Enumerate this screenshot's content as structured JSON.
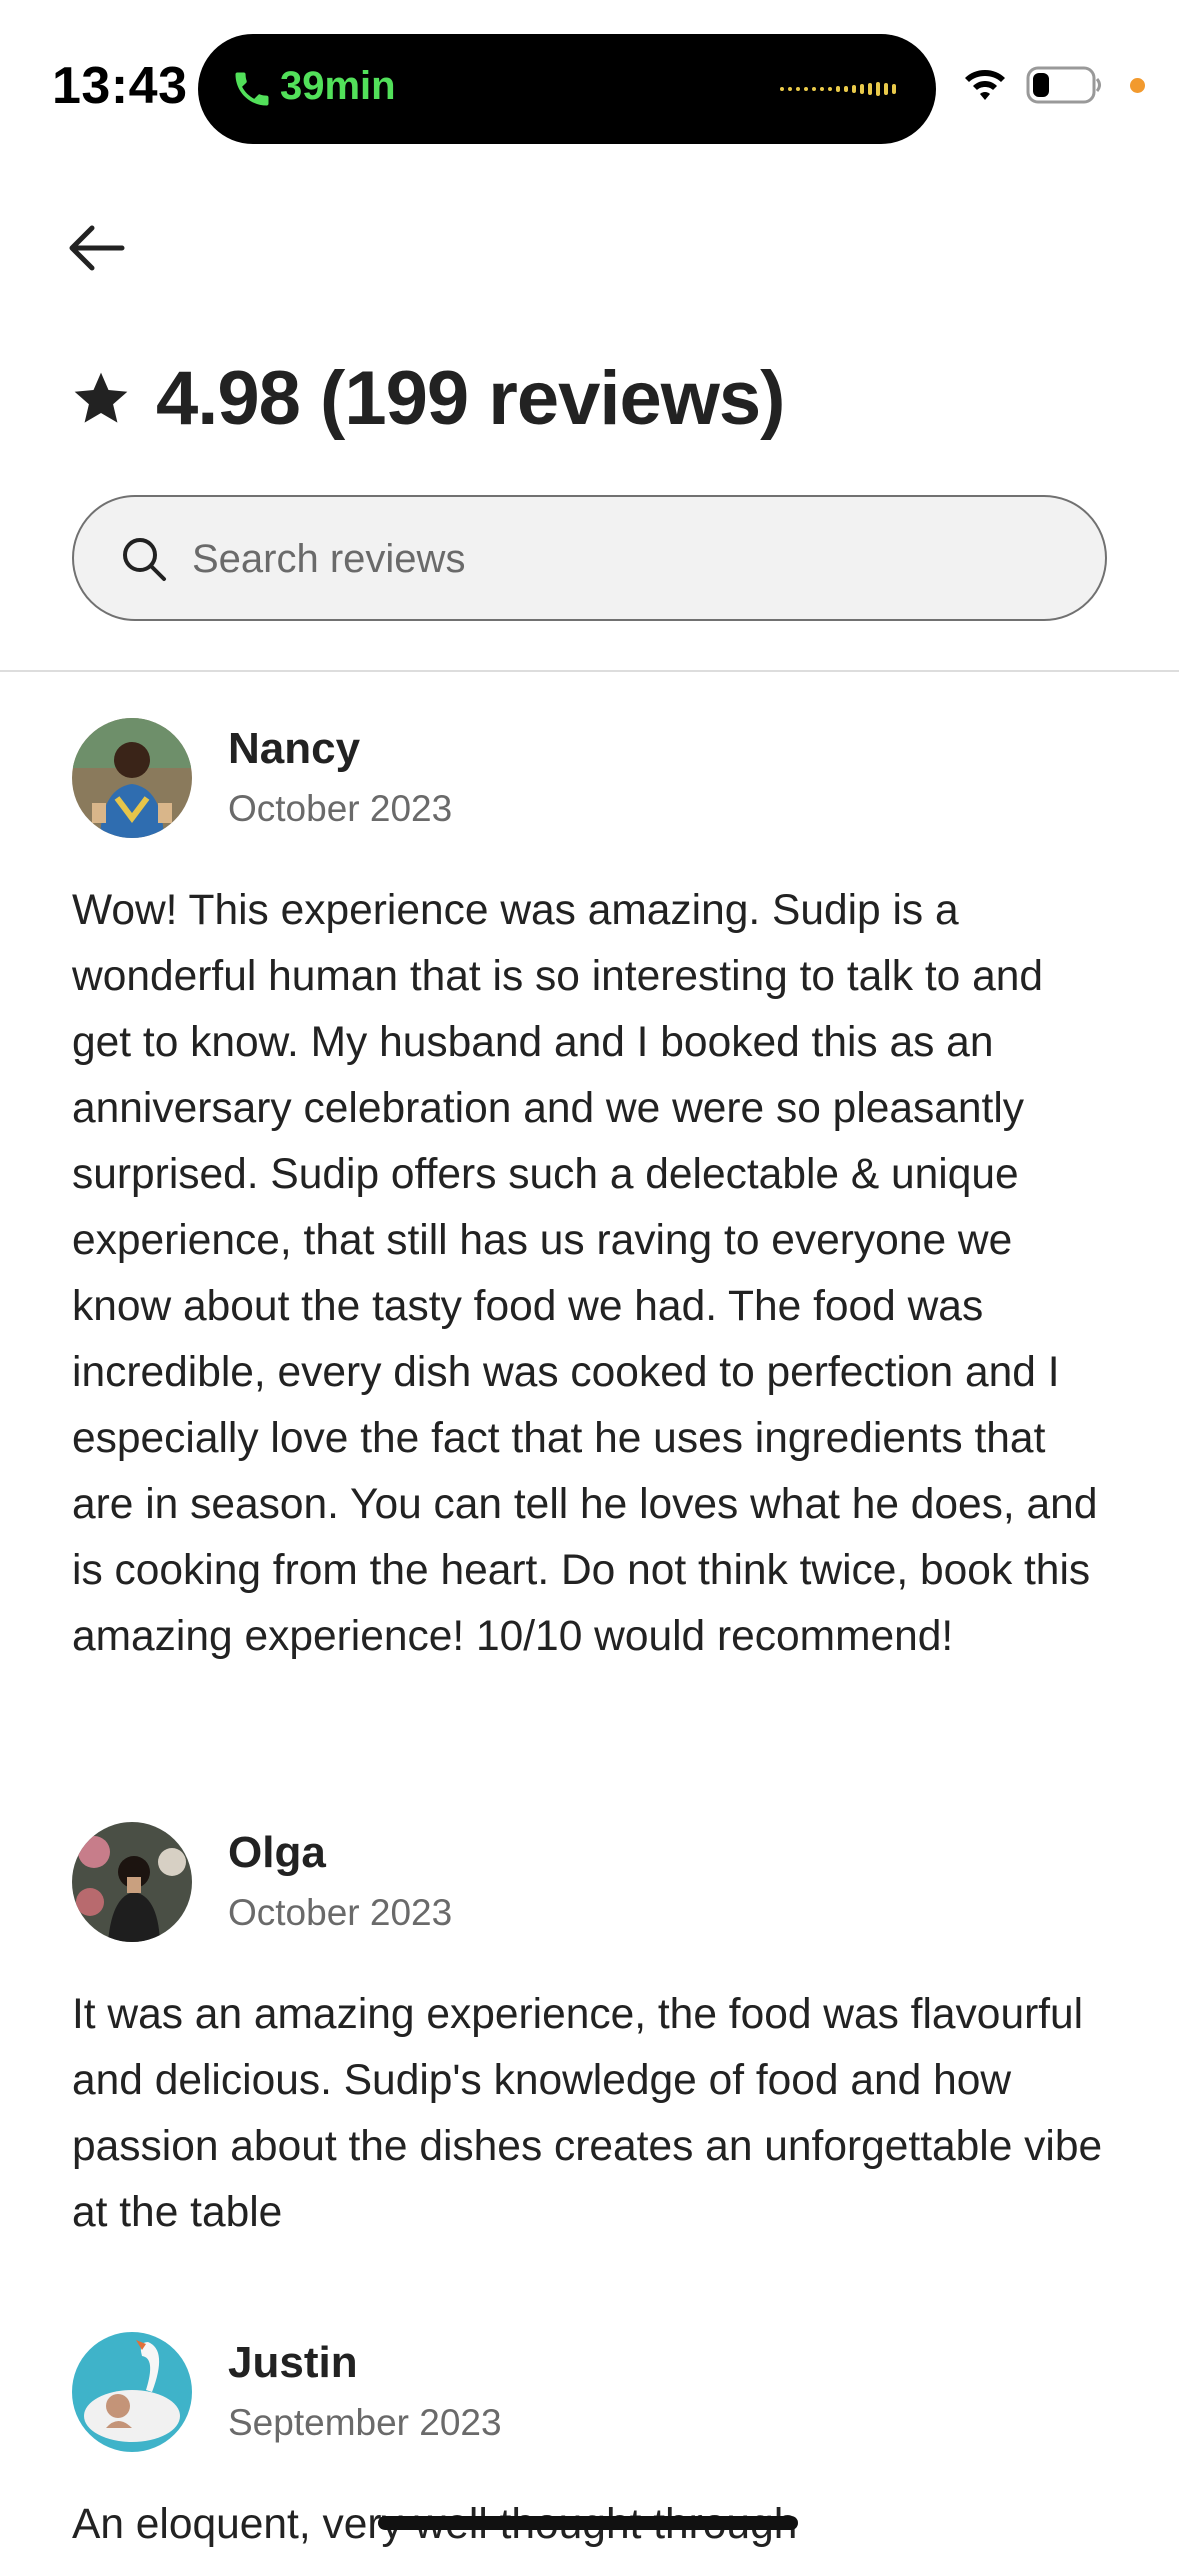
{
  "status_bar": {
    "time": "13:43",
    "call_duration": "39min",
    "call_color": "#52e05a",
    "icons": [
      "phone-icon",
      "audio-wave-icon",
      "wifi-icon",
      "battery-icon",
      "privacy-dot"
    ]
  },
  "header": {
    "back_icon": "arrow-left-icon",
    "rating_icon": "star-icon",
    "rating_text": "4.98 (199 reviews)"
  },
  "search": {
    "placeholder": "Search reviews",
    "value": "",
    "icon": "search-icon"
  },
  "reviews": [
    {
      "name": "Nancy",
      "date": "October 2023",
      "text": "Wow! This experience was amazing. Sudip is a wonderful human that is so interesting to talk to and get to know. My husband and I booked this as an anniversary celebration and we were so pleasantly surprised. Sudip offers such a delectable & unique experience, that still has us raving to everyone we know about the tasty food we had. The food was incredible, every dish was cooked to perfection and I especially love the fact that he uses ingredients that are in season. You can tell he loves what he does, and is cooking from the heart. Do not think twice, book this amazing experience! 10/10 would recommend!"
    },
    {
      "name": "Olga",
      "date": "October 2023",
      "text": "It was an amazing experience, the food was flavourful and delicious. Sudip's knowledge of food and how passion about the dishes creates an unforgettable vibe at the table"
    },
    {
      "name": "Justin",
      "date": "September 2023",
      "text": "An eloquent, very well thought through"
    }
  ],
  "colors": {
    "text_primary": "#222222",
    "text_secondary": "#6a6a6a",
    "divider": "#dddddd",
    "search_bg": "#f2f2f2",
    "privacy_dot": "#f29a2e"
  }
}
